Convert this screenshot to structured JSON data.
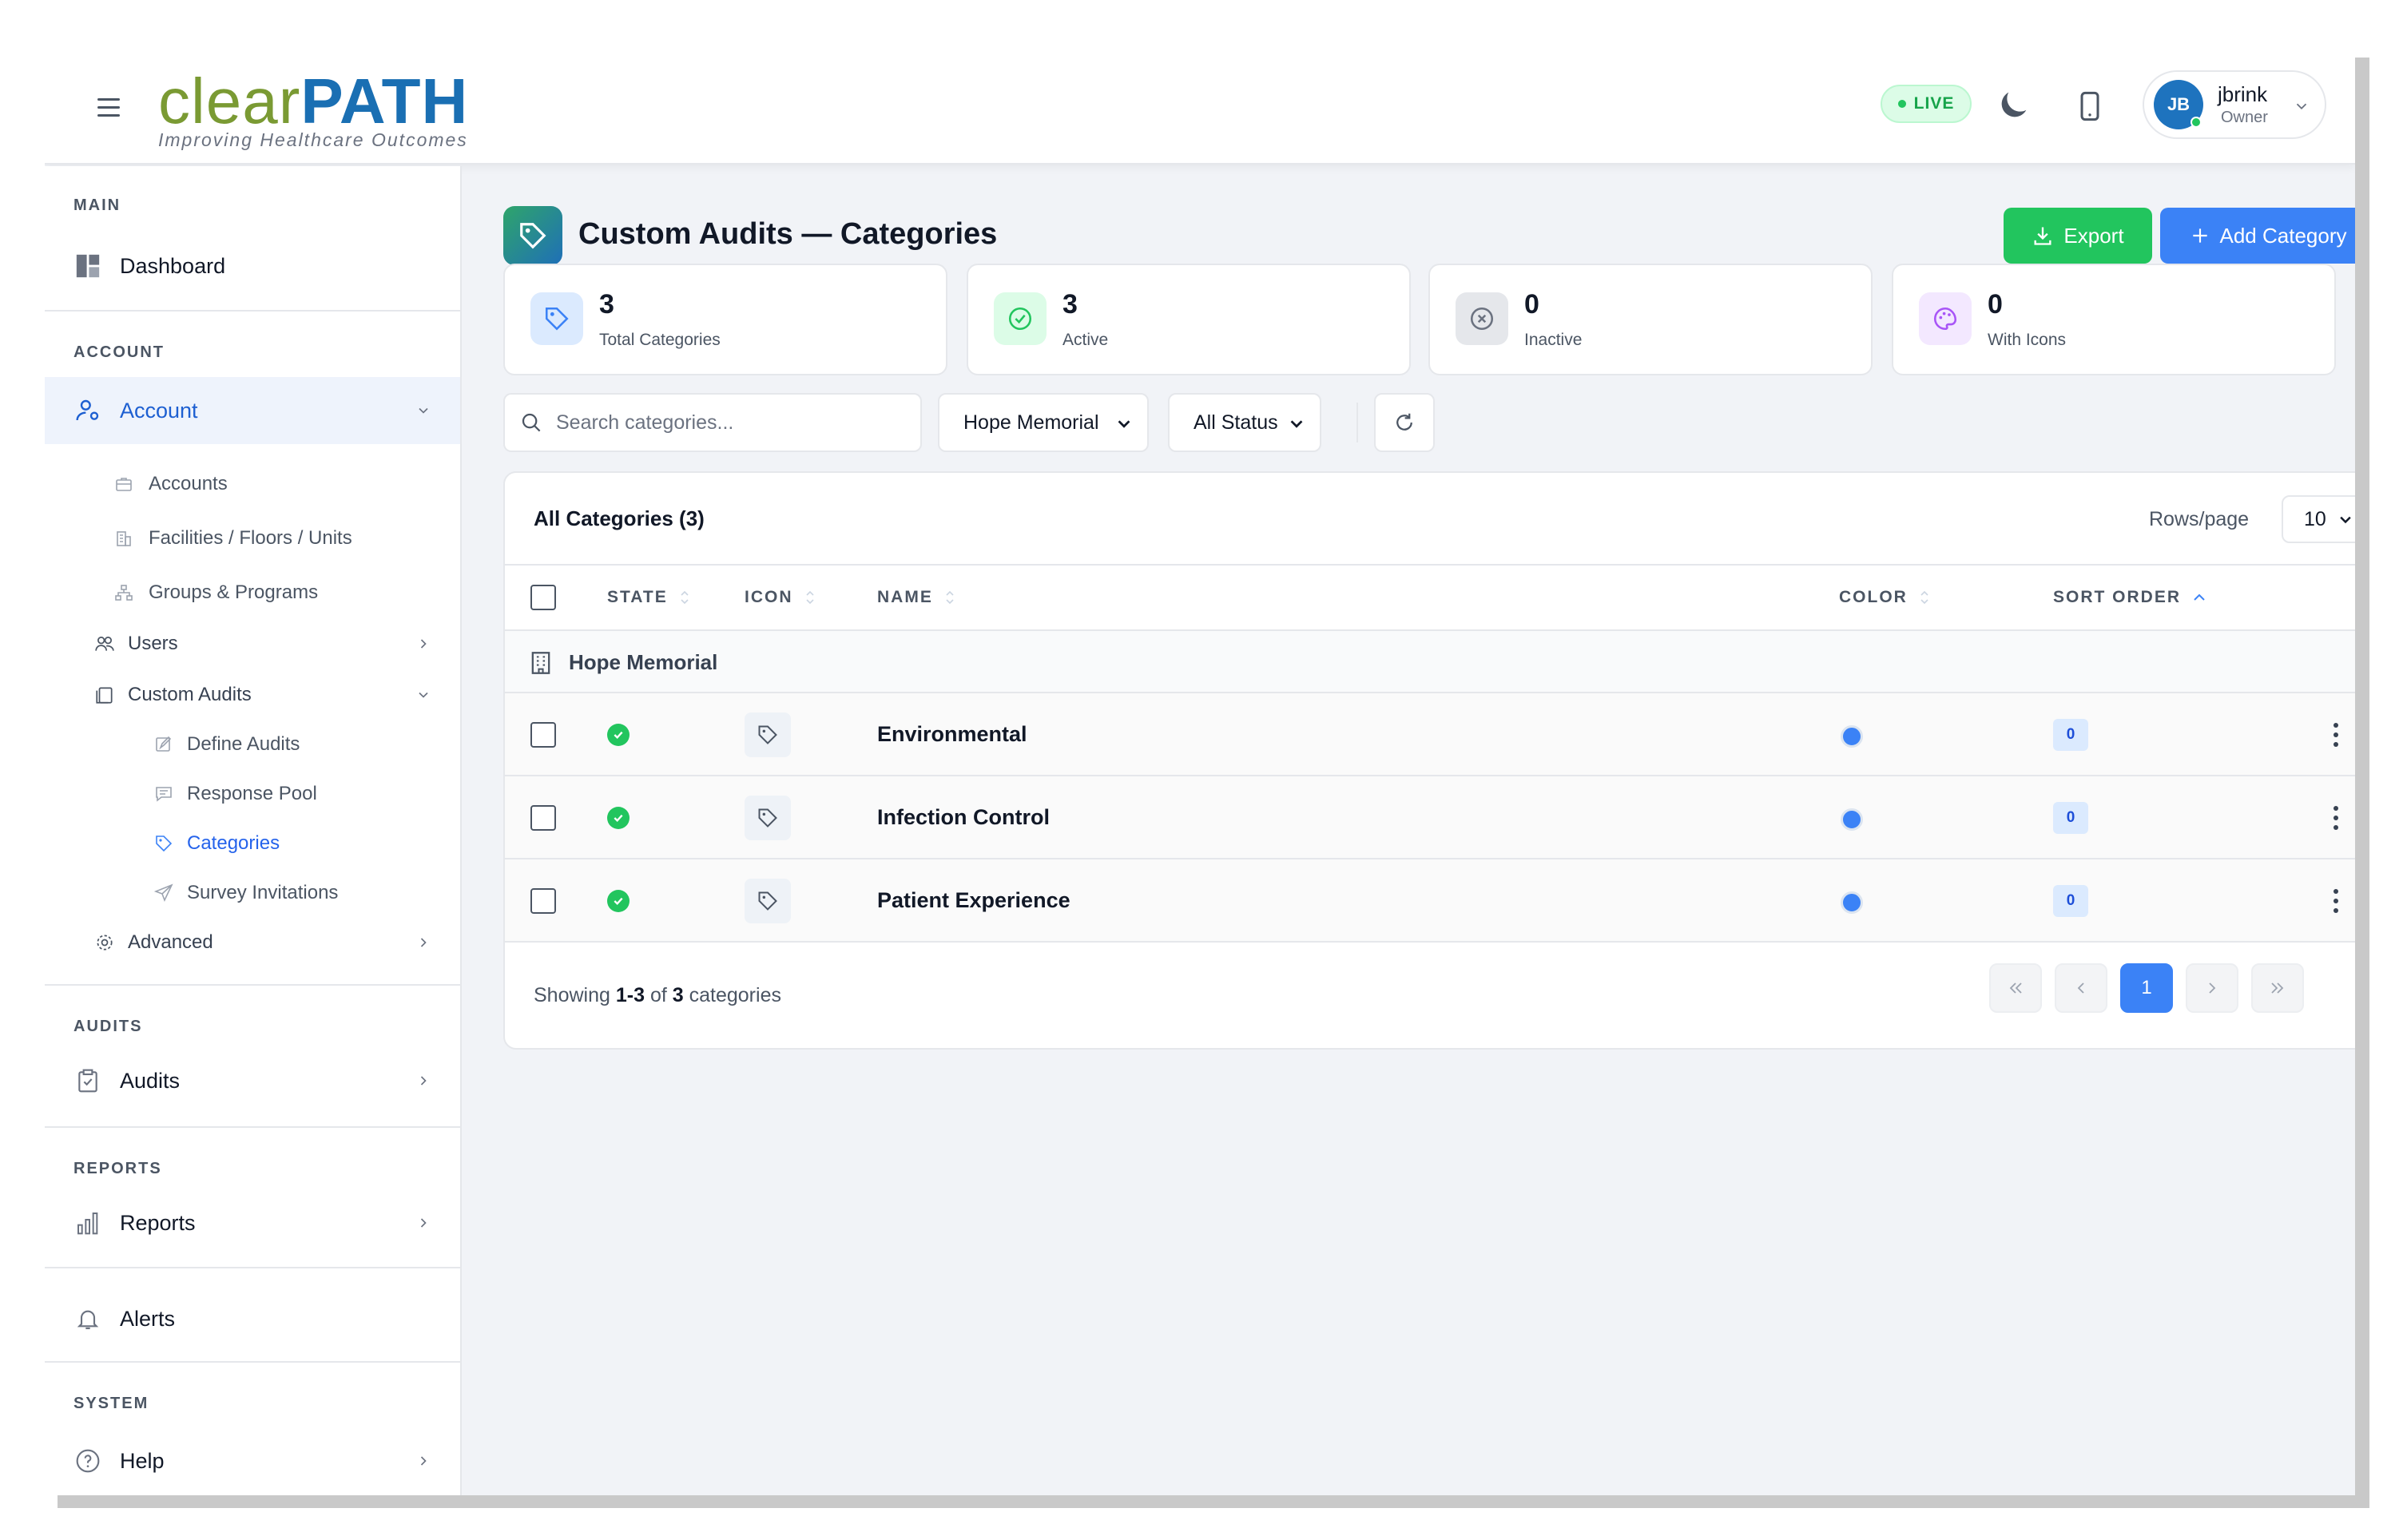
{
  "header": {
    "logo_clear": "clear",
    "logo_path": "PATH",
    "logo_tagline": "Improving Healthcare Outcomes",
    "live_label": "LIVE",
    "user": {
      "initials": "JB",
      "name": "jbrink",
      "role": "Owner"
    }
  },
  "sidebar": {
    "main_title": "MAIN",
    "dashboard": "Dashboard",
    "account_title": "ACCOUNT",
    "account": "Account",
    "accounts": "Accounts",
    "facilities": "Facilities / Floors / Units",
    "groups": "Groups & Programs",
    "users": "Users",
    "custom_audits": "Custom Audits",
    "define_audits": "Define Audits",
    "response_pool": "Response Pool",
    "categories": "Categories",
    "survey_invitations": "Survey Invitations",
    "advanced": "Advanced",
    "audits_title": "AUDITS",
    "audits": "Audits",
    "reports_title": "REPORTS",
    "reports": "Reports",
    "alerts": "Alerts",
    "system_title": "SYSTEM",
    "help": "Help"
  },
  "page": {
    "title": "Custom Audits — Categories",
    "export_label": "Export",
    "add_label": "Add Category"
  },
  "stats": [
    {
      "value": "3",
      "label": "Total Categories",
      "icon": "tag-icon",
      "color": "#3b82f6"
    },
    {
      "value": "3",
      "label": "Active",
      "icon": "check-circle-icon",
      "color": "#22c55e"
    },
    {
      "value": "0",
      "label": "Inactive",
      "icon": "x-circle-icon",
      "color": "#6b7280"
    },
    {
      "value": "0",
      "label": "With Icons",
      "icon": "palette-icon",
      "color": "#a855f7"
    }
  ],
  "filters": {
    "search_placeholder": "Search categories...",
    "facility": "Hope Memorial",
    "status": "All Status"
  },
  "table": {
    "title": "All Categories (3)",
    "rows_per_page_label": "Rows/page",
    "rows_per_page": "10",
    "columns": {
      "state": "STATE",
      "icon": "ICON",
      "name": "NAME",
      "color": "COLOR",
      "sort_order": "SORT ORDER"
    },
    "group": "Hope Memorial",
    "rows": [
      {
        "name": "Environmental",
        "color": "#3b82f6",
        "sort_order": "0"
      },
      {
        "name": "Infection Control",
        "color": "#3b82f6",
        "sort_order": "0"
      },
      {
        "name": "Patient Experience",
        "color": "#3b82f6",
        "sort_order": "0"
      }
    ],
    "footer": {
      "prefix": "Showing",
      "range": "1-3",
      "of": "of",
      "total": "3",
      "suffix": "categories"
    },
    "current_page": "1"
  }
}
